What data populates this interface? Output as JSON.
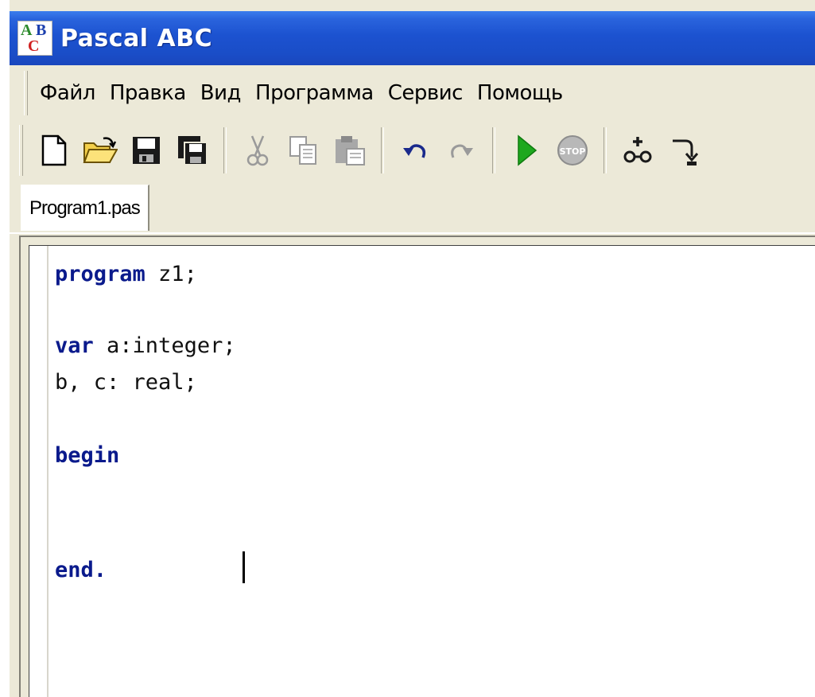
{
  "window": {
    "title": "Pascal ABC",
    "icon": "pascal-abc-app-icon",
    "icon_letters": {
      "a": "A",
      "b": "B",
      "c": "C"
    }
  },
  "menu": {
    "items": [
      {
        "label": "Файл"
      },
      {
        "label": "Правка"
      },
      {
        "label": "Вид"
      },
      {
        "label": "Программа"
      },
      {
        "label": "Сервис"
      },
      {
        "label": "Помощь"
      }
    ]
  },
  "toolbar": {
    "groups": [
      [
        "new-file-icon",
        "open-folder-icon",
        "save-icon",
        "save-all-icon"
      ],
      [
        "cut-icon",
        "copy-icon",
        "paste-icon"
      ],
      [
        "undo-icon",
        "redo-icon"
      ],
      [
        "run-icon",
        "stop-icon"
      ],
      [
        "add-watch-icon",
        "step-into-icon"
      ]
    ],
    "stop_text": "STOP"
  },
  "tabs": [
    {
      "label": "Program1.pas",
      "active": true
    }
  ],
  "editor": {
    "lines": [
      {
        "kw": "program",
        "rest": " z1;"
      },
      {
        "kw": "",
        "rest": ""
      },
      {
        "kw": "var",
        "rest": " a:integer;"
      },
      {
        "kw": "",
        "rest": "b, c: real;"
      },
      {
        "kw": "",
        "rest": ""
      },
      {
        "kw": "begin",
        "rest": ""
      },
      {
        "kw": "",
        "rest": ""
      },
      {
        "kw": "",
        "rest": ""
      },
      {
        "kw": "end.",
        "rest": ""
      }
    ]
  },
  "colors": {
    "titlebar": "#1c52d0",
    "keyword": "#0a1a8c",
    "chrome": "#ece9d8",
    "run_green": "#1ea81e"
  }
}
